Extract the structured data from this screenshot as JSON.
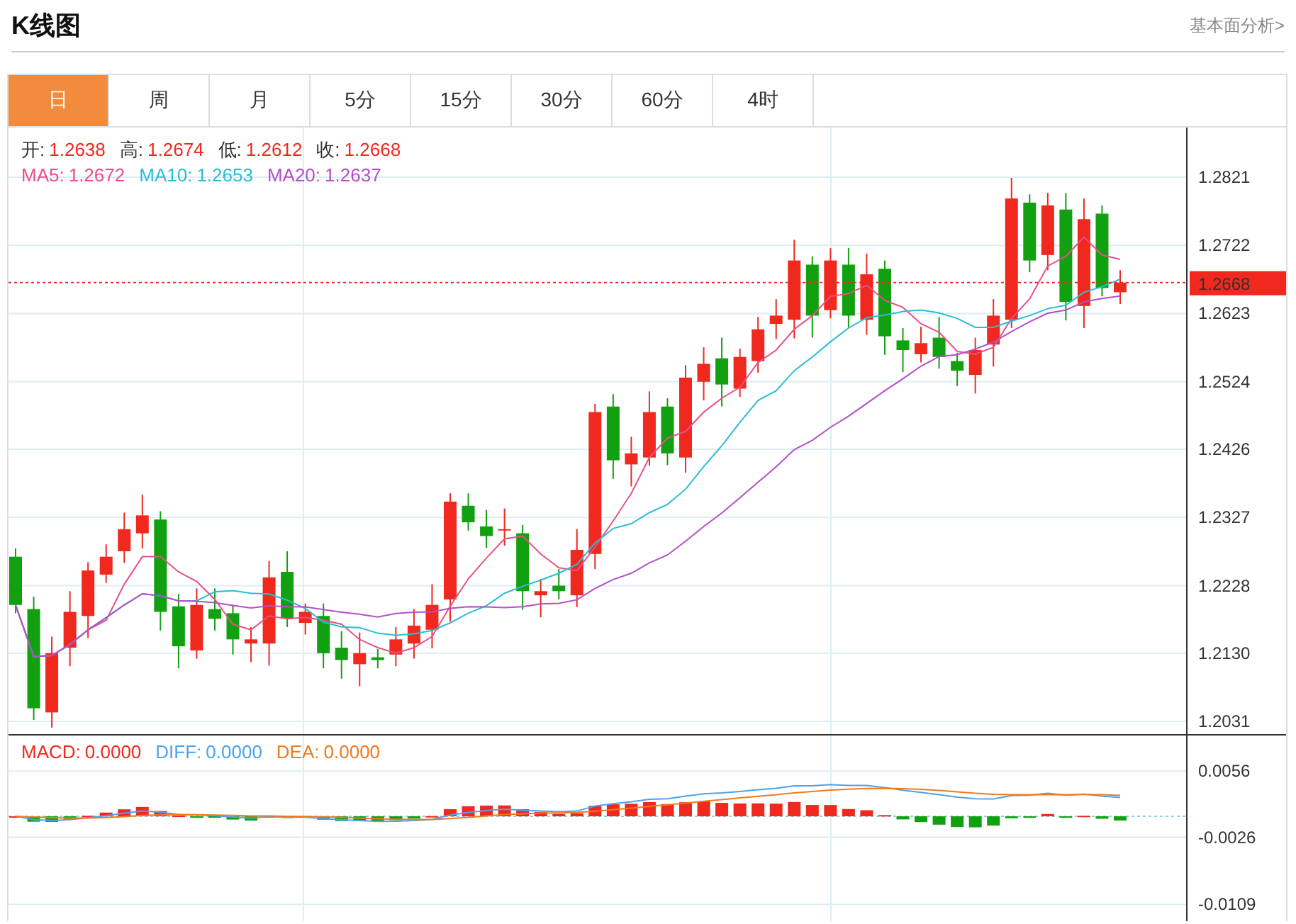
{
  "header": {
    "title": "K线图",
    "link": "基本面分析>"
  },
  "tabs": [
    {
      "label": "日",
      "selected": true
    },
    {
      "label": "周",
      "selected": false
    },
    {
      "label": "月",
      "selected": false
    },
    {
      "label": "5分",
      "selected": false
    },
    {
      "label": "15分",
      "selected": false
    },
    {
      "label": "30分",
      "selected": false
    },
    {
      "label": "60分",
      "selected": false
    },
    {
      "label": "4时",
      "selected": false
    }
  ],
  "quote": [
    {
      "label": "开:",
      "value": "1.2638"
    },
    {
      "label": "高:",
      "value": "1.2674"
    },
    {
      "label": "低:",
      "value": "1.2612"
    },
    {
      "label": "收:",
      "value": "1.2668"
    }
  ],
  "ma_legend": [
    {
      "label": "MA5:",
      "value": "1.2672",
      "color": "#e8508a"
    },
    {
      "label": "MA10:",
      "value": "1.2653",
      "color": "#2bbcd8"
    },
    {
      "label": "MA20:",
      "value": "1.2637",
      "color": "#b44fc8"
    }
  ],
  "price_axis": [
    "1.2821",
    "1.2722",
    "1.2623",
    "1.2524",
    "1.2426",
    "1.2327",
    "1.2228",
    "1.2130",
    "1.2031"
  ],
  "current_price": "1.2668",
  "macd_legend": [
    {
      "label": "MACD:",
      "value": "0.0000",
      "color": "#f0281e"
    },
    {
      "label": "DIFF:",
      "value": "0.0000",
      "color": "#4aa3f0"
    },
    {
      "label": "DEA:",
      "value": "0.0000",
      "color": "#f07a1e"
    }
  ],
  "macd_axis": [
    "0.0056",
    "-0.0026",
    "-0.0109"
  ]
}
